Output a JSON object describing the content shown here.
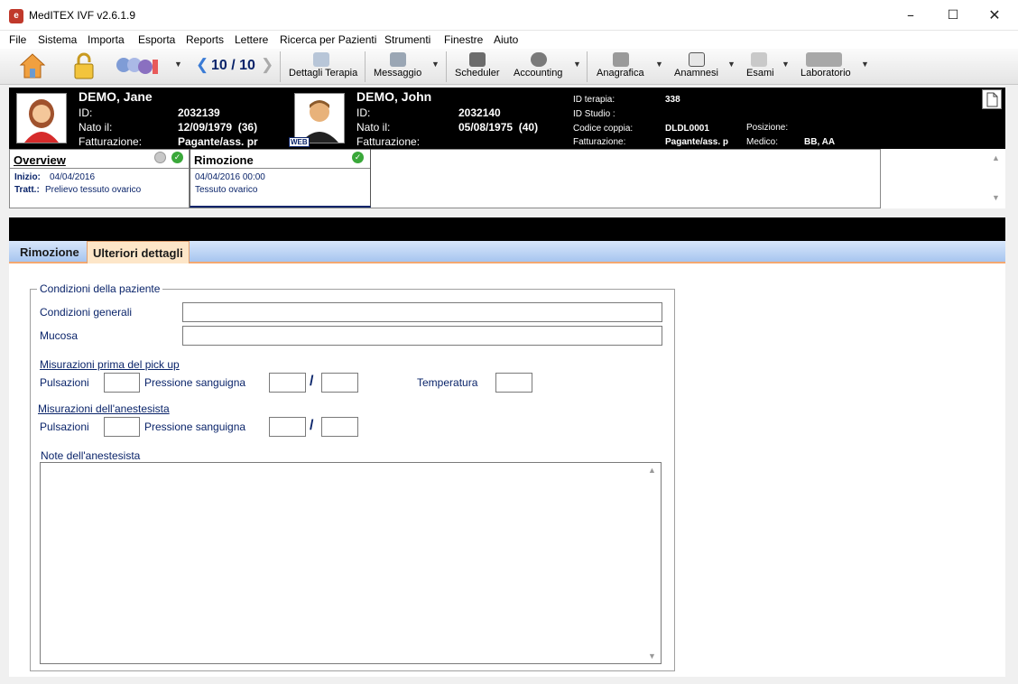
{
  "window": {
    "title": "MedITEX IVF v2.6.1.9"
  },
  "menu": [
    "File",
    "Sistema",
    "Importa",
    "Esporta",
    "Reports",
    "Lettere",
    "Ricerca per Pazienti",
    "Strumenti",
    "Finestre",
    "Aiuto"
  ],
  "toolbar": {
    "counter": "10 / 10",
    "dettagli": "Dettagli Terapia",
    "messaggio": "Messaggio",
    "scheduler": "Scheduler",
    "accounting": "Accounting",
    "anagrafica": "Anagrafica",
    "anamnesi": "Anamnesi",
    "esami": "Esami",
    "laboratorio": "Laboratorio"
  },
  "female": {
    "name": "DEMO, Jane",
    "id_label": "ID:",
    "id": "2032139",
    "born_label": "Nato il:",
    "born": "12/09/1979  (36)",
    "billing_label": "Fatturazione:",
    "billing": "Pagante/ass. pr"
  },
  "male": {
    "name": "DEMO, John",
    "id_label": "ID:",
    "id": "2032140",
    "born_label": "Nato il:",
    "born": "05/08/1975  (40)",
    "billing_label": "Fatturazione:",
    "web_badge": "WEB"
  },
  "therapy": {
    "id_label": "ID terapia:",
    "id": "338",
    "study_label": "ID Studio :",
    "couple_label": "Codice coppia:",
    "couple": "DLDL0001",
    "position_label": "Posizione:",
    "billing_label": "Fatturazione:",
    "billing": "Pagante/ass. p",
    "doctor_label": "Medico:",
    "doctor": "BB, AA"
  },
  "overview": {
    "title": "Overview",
    "start_label": "Inizio:",
    "start": "04/04/2016",
    "treat_label": "Tratt.:",
    "treat": "Prelievo tessuto ovarico"
  },
  "rimozione_col": {
    "title": "Rimozione",
    "date": "04/04/2016 00:00",
    "desc": "Tessuto ovarico"
  },
  "tabs": [
    "Rimozione",
    "Ulteriori dettagli"
  ],
  "form": {
    "group_title": "Condizioni della paziente",
    "general_label": "Condizioni generali",
    "general_value": "",
    "mucosa_label": "Mucosa",
    "mucosa_value": "",
    "pre_title": "Misurazioni prima del pick up",
    "pulse_label": "Pulsazioni",
    "bp_label": "Pressione sanguigna",
    "slash": "/",
    "temp_label": "Temperatura",
    "anest_title": "Misurazioni dell'anestesista",
    "notes_label": "Note dell'anestesista",
    "notes_value": ""
  },
  "colors": {
    "accent": "#0a246a",
    "tab_active": "#fde6c8",
    "header_bg": "#000000",
    "ok_green": "#3aa83a"
  }
}
